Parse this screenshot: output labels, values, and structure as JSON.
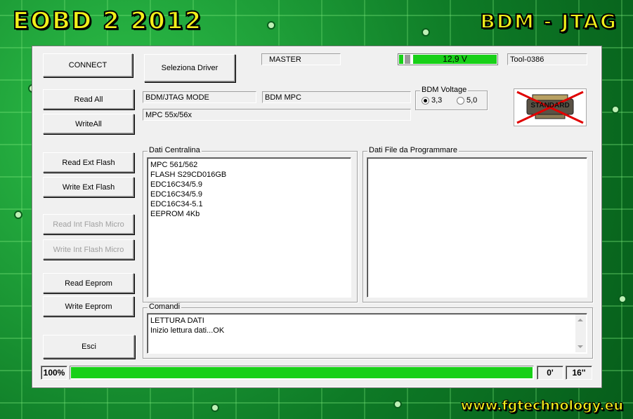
{
  "header": {
    "title": "EOBD 2 2012",
    "mode": "BDM - JTAG",
    "website": "www.fgtechnology.eu"
  },
  "toolbar": {
    "connect_label": "CONNECT",
    "select_driver_label": "Seleziona Driver",
    "master_label": "MASTER",
    "voltage_value": "12,9 V",
    "tool_id": "Tool-0386"
  },
  "info": {
    "mode_field": "BDM/JTAG  MODE",
    "protocol_field": "BDM MPC",
    "cpu_field": "MPC 55x/56x"
  },
  "bdm_voltage": {
    "caption": "BDM Voltage",
    "options": [
      {
        "label": "3,3",
        "selected": true
      },
      {
        "label": "5,0",
        "selected": false
      }
    ]
  },
  "standard_badge": {
    "text": "STANDARD",
    "icon": "crossed-out-connector-icon"
  },
  "buttons": {
    "read_all": "Read All",
    "write_all": "WriteAll",
    "read_ext_flash": "Read Ext Flash",
    "write_ext_flash": "Write Ext Flash",
    "read_int_flash": "Read Int Flash Micro",
    "write_int_flash": "Write Int Flash Micro",
    "read_eeprom": "Read Eeprom",
    "write_eeprom": "Write Eeprom",
    "exit": "Esci"
  },
  "ecu_data": {
    "caption": "Dati Centralina",
    "lines": [
      "MPC 561/562",
      "FLASH S29CD016GB",
      "EDC16C34/5.9",
      "EDC16C34/5.9",
      "EDC16C34-5.1",
      "EEPROM  4Kb"
    ]
  },
  "file_data": {
    "caption": "Dati File da Programmare"
  },
  "commands": {
    "caption": "Comandi",
    "lines": [
      "LETTURA DATI",
      "Inizio lettura dati...OK"
    ]
  },
  "progress": {
    "percent_label": "100%",
    "percent": 100,
    "time_minutes": "0'",
    "time_seconds": "16''"
  },
  "colors": {
    "title_yellow": "#f2ef1a",
    "progress_green": "#18d018",
    "board_green": "#0f8a2c"
  }
}
